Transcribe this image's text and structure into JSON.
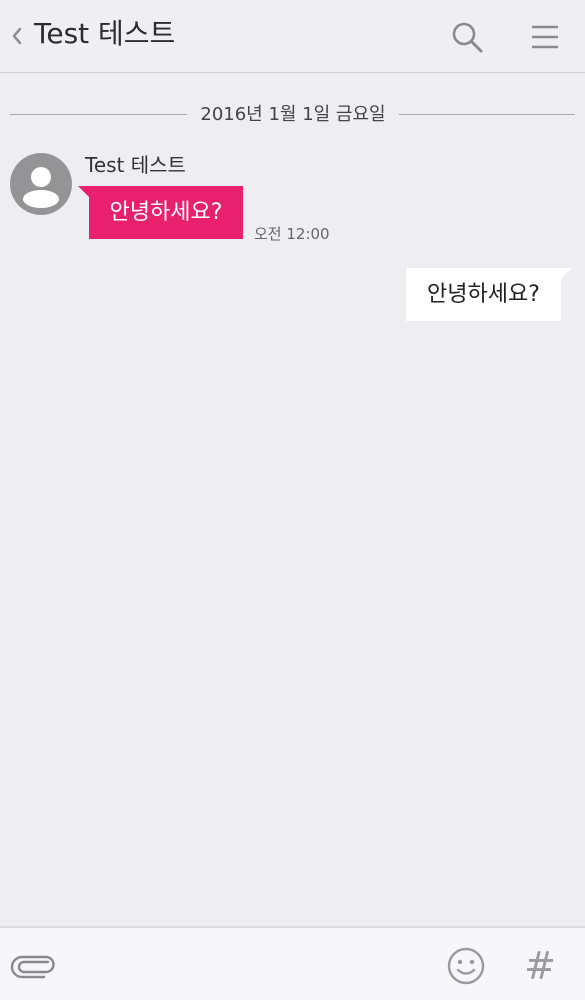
{
  "header": {
    "title": "Test 테스트",
    "back_icon": "chevron-left-icon",
    "search_icon": "search-icon",
    "menu_icon": "hamburger-menu-icon"
  },
  "chat": {
    "date_separator": "2016년 1월 1일 금요일",
    "messages": [
      {
        "direction": "incoming",
        "sender": "Test 테스트",
        "text": "안녕하세요?",
        "time": "오전 12:00",
        "bubble_color": "#e9206e"
      },
      {
        "direction": "outgoing",
        "text": "안녕하세요?",
        "bubble_color": "#ffffff"
      }
    ]
  },
  "bottom_bar": {
    "attach_icon": "paperclip-icon",
    "emoji_icon": "smiley-icon",
    "hashtag_label": "#"
  },
  "colors": {
    "background": "#eeedf1",
    "accent": "#e9206e",
    "icon_gray": "#8a8a8e"
  }
}
